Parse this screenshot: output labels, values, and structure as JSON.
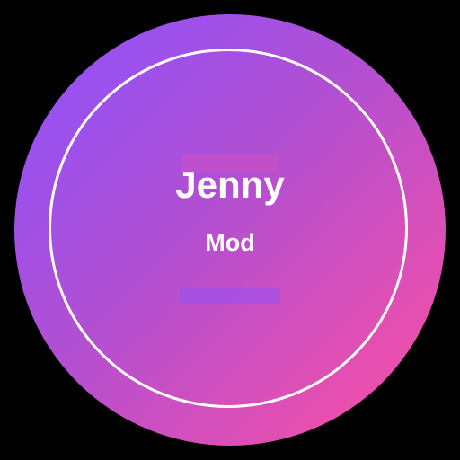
{
  "badge": {
    "name": "Jenny",
    "subtitle": "Mod",
    "colors": {
      "background": "#000000",
      "gradient_start": "#8c52ff",
      "gradient_mid": "#b14fd2",
      "gradient_end": "#ff4fa0",
      "ring": "#ffffff",
      "text": "#ffffff"
    }
  }
}
